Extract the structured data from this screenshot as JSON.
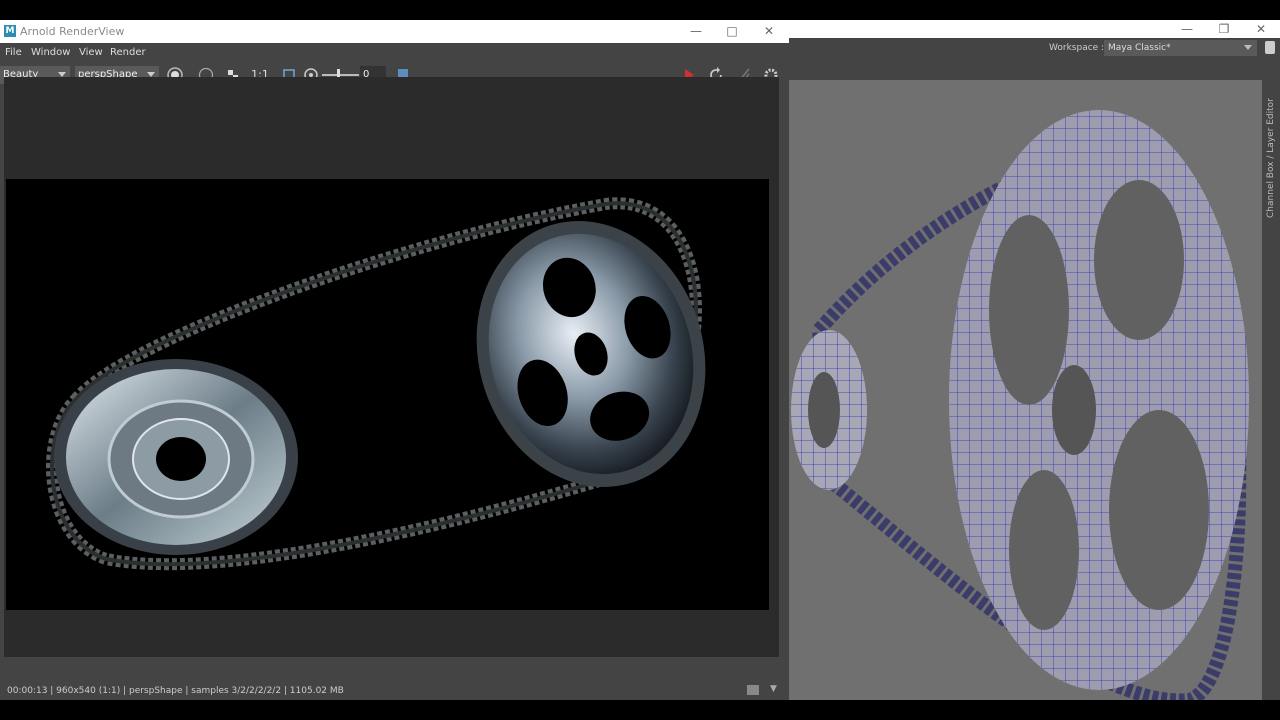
{
  "arnold": {
    "title": "Arnold RenderView",
    "menu": [
      "File",
      "Window",
      "View",
      "Render"
    ],
    "toolbar": {
      "aov": "Beauty",
      "camera": "perspShape",
      "ratio": "1:1",
      "exposure": "0"
    },
    "status": "00:00:13 | 960x540 (1:1) | perspShape  | samples 3/2/2/2/2/2 | 1105.02 MB"
  },
  "maya": {
    "workspace_label": "Workspace :",
    "workspace_value": "Maya Classic*",
    "side_panel": "Channel Box / Layer Editor"
  },
  "colors": {
    "accent_red": "#d03030",
    "wire_blue": "#2a2ab0"
  }
}
